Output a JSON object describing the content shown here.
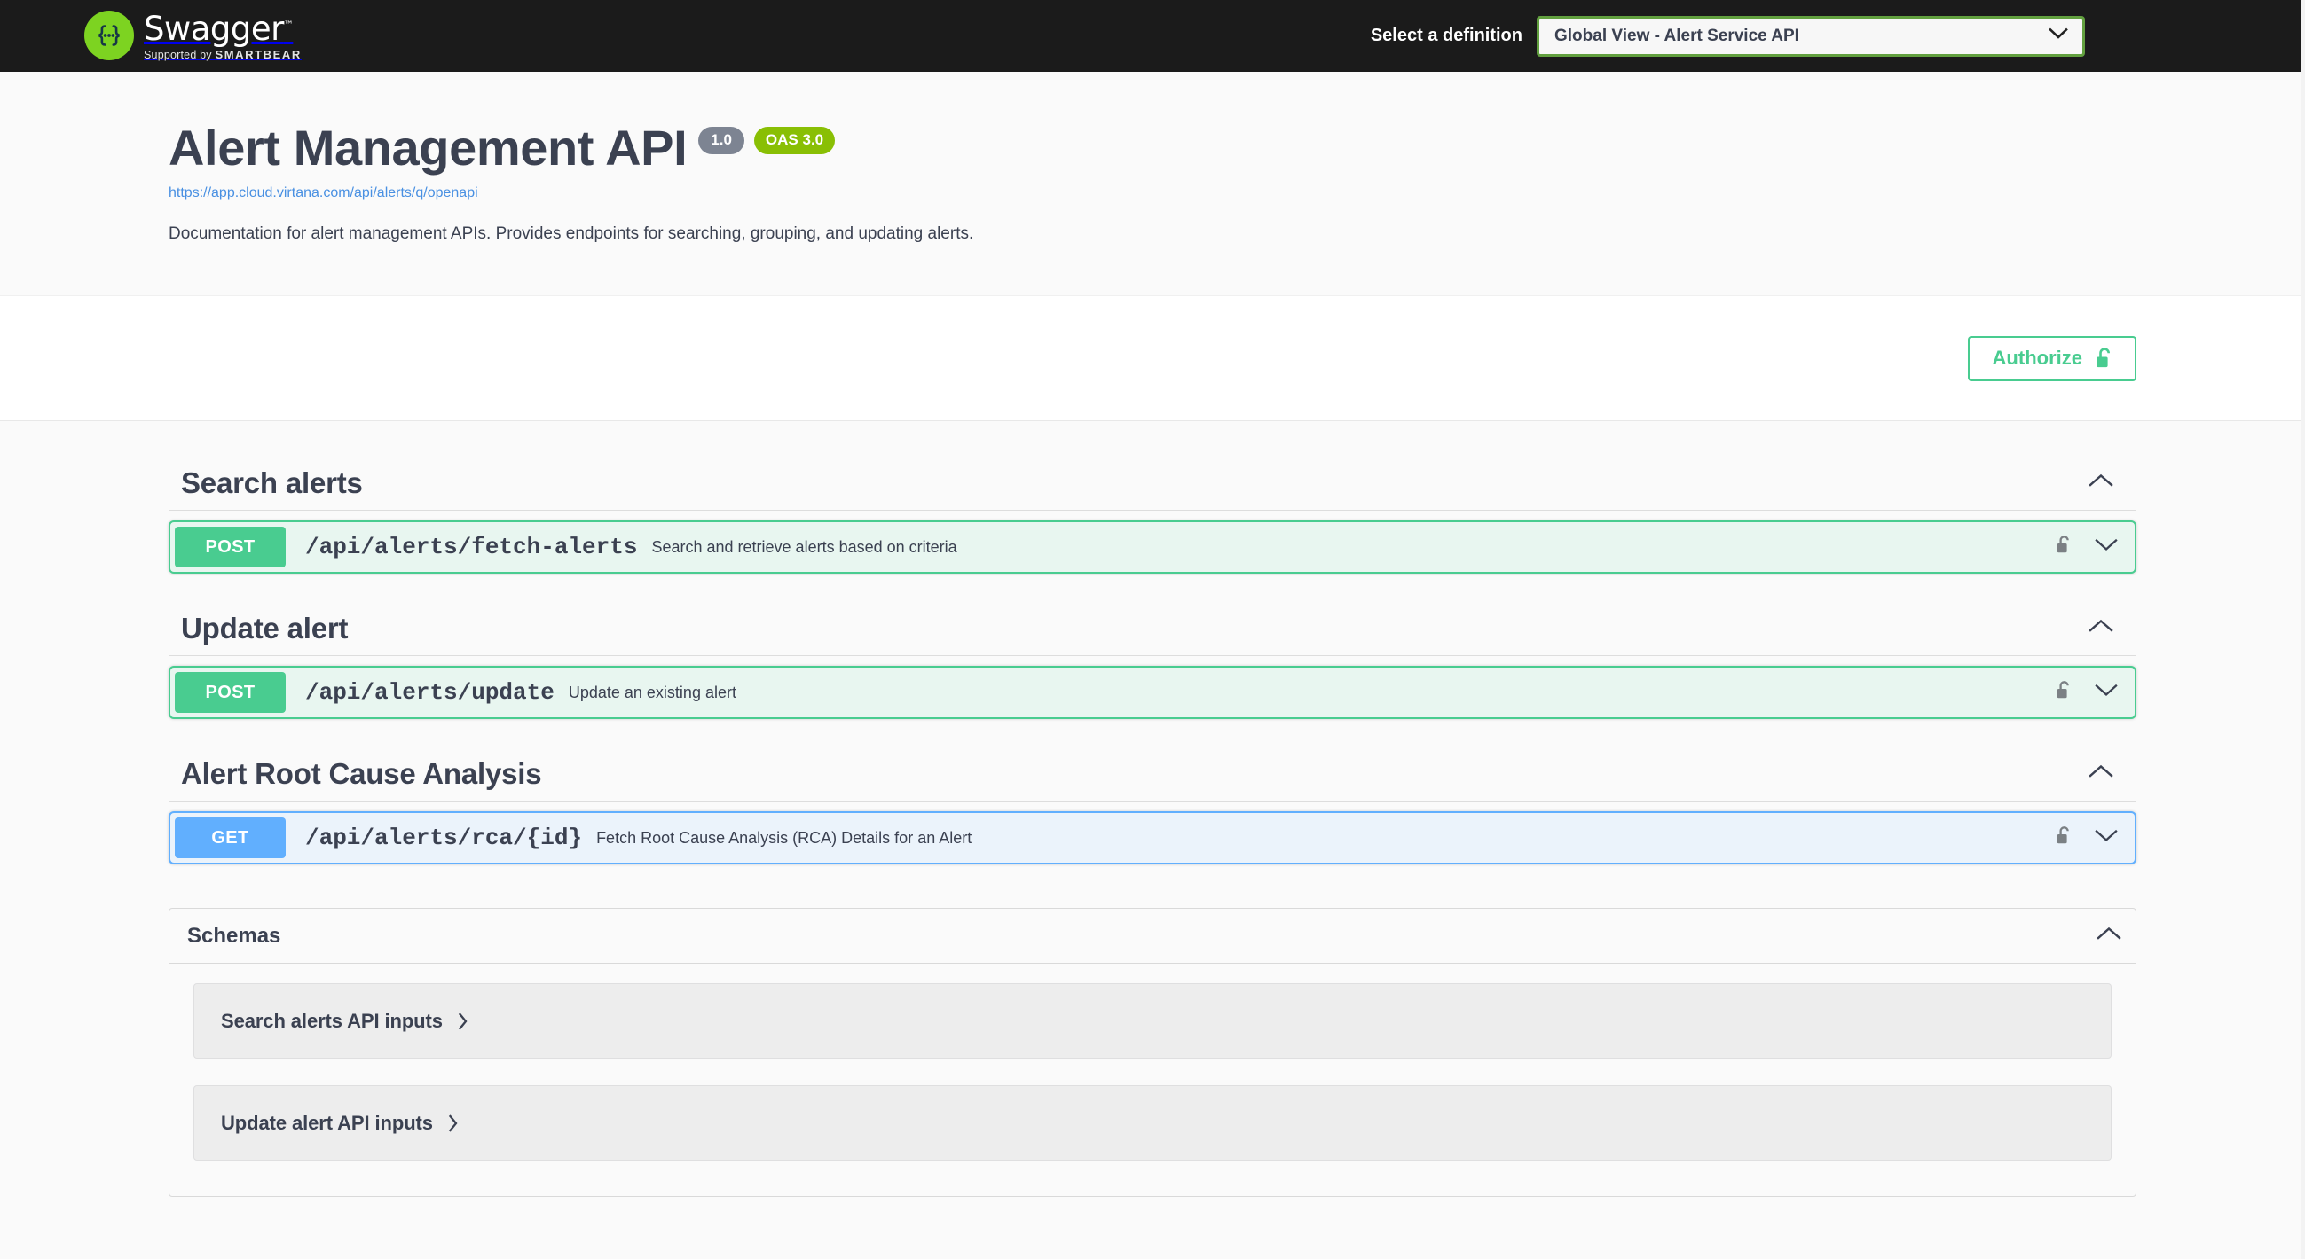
{
  "topbar": {
    "logo_name": "Swagger",
    "logo_tm": "™",
    "logo_supported_prefix": "Supported by ",
    "logo_supported_brand": "SMARTBEAR",
    "definition_label": "Select a definition",
    "definition_selected": "Global View - Alert Service API",
    "background": "#1b1b1b",
    "logo_green": "#7dd321",
    "select_border": "#62a03f"
  },
  "info": {
    "title": "Alert Management API",
    "version_badge": "1.0",
    "oas_badge": "OAS 3.0",
    "spec_url": "https://app.cloud.virtana.com/api/alerts/q/openapi",
    "description": "Documentation for alert management APIs. Provides endpoints for searching, grouping, and updating alerts.",
    "version_badge_color": "#7d8492",
    "oas_badge_color": "#89bf04",
    "link_color": "#4990e2"
  },
  "auth": {
    "authorize_label": "Authorize",
    "lock_state": "unlocked",
    "accent": "#49cc90"
  },
  "sections": [
    {
      "title": "Search alerts",
      "expanded": true,
      "operations": [
        {
          "method": "POST",
          "path": "/api/alerts/fetch-alerts",
          "summary": "Search and retrieve alerts based on criteria",
          "locked": true,
          "expanded": false,
          "color": "#49cc90"
        }
      ]
    },
    {
      "title": "Update alert",
      "expanded": true,
      "operations": [
        {
          "method": "POST",
          "path": "/api/alerts/update",
          "summary": "Update an existing alert",
          "locked": true,
          "expanded": false,
          "color": "#49cc90"
        }
      ]
    },
    {
      "title": "Alert Root Cause Analysis",
      "expanded": true,
      "operations": [
        {
          "method": "GET",
          "path": "/api/alerts/rca/{id}",
          "summary": "Fetch Root Cause Analysis (RCA) Details for an Alert",
          "locked": true,
          "expanded": false,
          "color": "#61affe"
        }
      ]
    }
  ],
  "schemas": {
    "title": "Schemas",
    "expanded": true,
    "models": [
      {
        "name": "Search alerts API inputs",
        "expanded": false
      },
      {
        "name": "Update alert API inputs",
        "expanded": false
      }
    ]
  },
  "icons": {
    "chevron_down": "chevron-down-icon",
    "chevron_up": "chevron-up-icon",
    "chevron_right": "chevron-right-icon",
    "lock": "unlocked-padlock-icon"
  }
}
